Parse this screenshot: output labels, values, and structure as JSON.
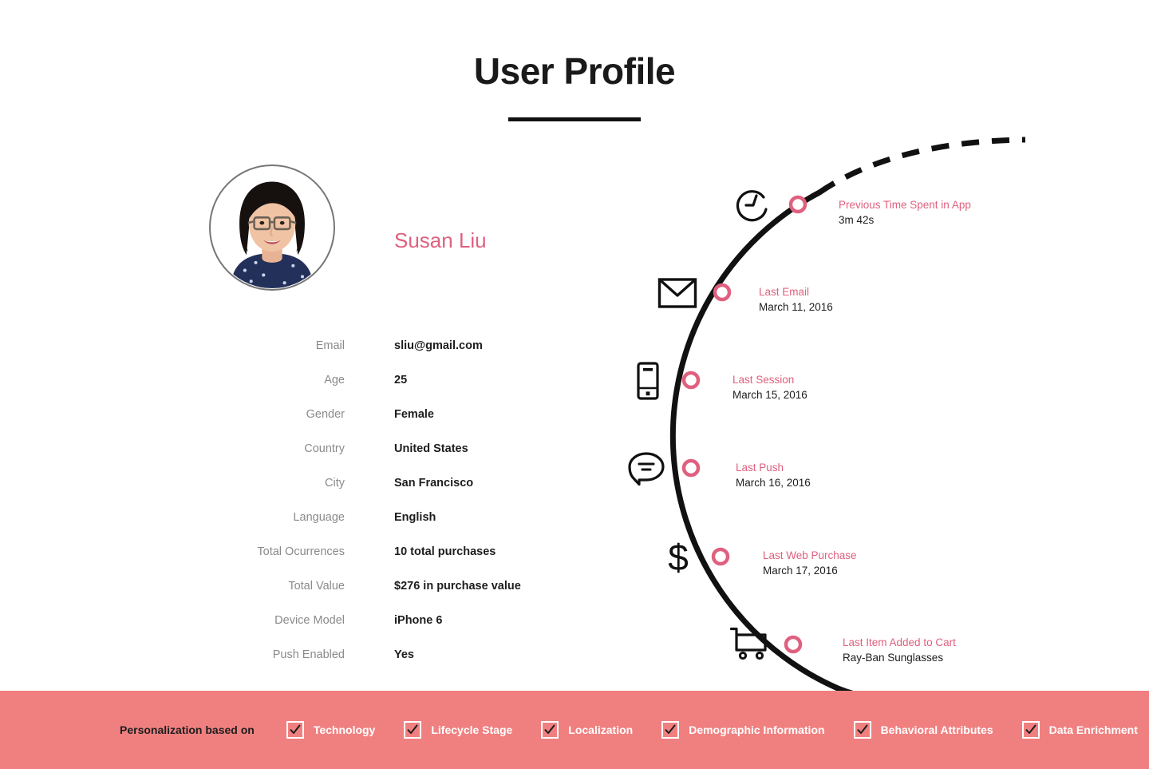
{
  "header": {
    "title": "User Profile"
  },
  "profile": {
    "avatar_icon": "user-photo",
    "name": "Susan Liu",
    "attributes": [
      {
        "label": "Email",
        "value": "sliu@gmail.com"
      },
      {
        "label": "Age",
        "value": "25"
      },
      {
        "label": "Gender",
        "value": "Female"
      },
      {
        "label": "Country",
        "value": "United States"
      },
      {
        "label": "City",
        "value": "San Francisco"
      },
      {
        "label": "Language",
        "value": "English"
      },
      {
        "label": "Total Ocurrences",
        "value": "10 total purchases"
      },
      {
        "label": "Total Value",
        "value": "$276 in purchase value"
      },
      {
        "label": "Device Model",
        "value": "iPhone 6"
      },
      {
        "label": "Push Enabled",
        "value": "Yes"
      }
    ]
  },
  "timeline": {
    "events": [
      {
        "icon": "clock-icon",
        "title": "Previous Time Spent in App",
        "detail": "3m 42s"
      },
      {
        "icon": "envelope-icon",
        "title": "Last Email",
        "detail": "March 11, 2016"
      },
      {
        "icon": "mobile-phone-icon",
        "title": "Last Session",
        "detail": "March 15, 2016"
      },
      {
        "icon": "speech-bubble-icon",
        "title": "Last Push",
        "detail": "March 16, 2016"
      },
      {
        "icon": "dollar-sign-icon",
        "title": "Last Web Purchase",
        "detail": "March 17, 2016"
      },
      {
        "icon": "shopping-cart-icon",
        "title": "Last Item Added to Cart",
        "detail": "Ray-Ban Sunglasses"
      }
    ]
  },
  "banner": {
    "label": "Personalization based on",
    "checkboxes": [
      {
        "label": "Technology",
        "checked": true
      },
      {
        "label": "Lifecycle Stage",
        "checked": true
      },
      {
        "label": "Localization",
        "checked": true
      },
      {
        "label": "Demographic Information",
        "checked": true
      },
      {
        "label": "Behavioral Attributes",
        "checked": true
      },
      {
        "label": "Data Enrichment",
        "checked": true
      }
    ]
  },
  "colors": {
    "accent_pink": "#e0607f",
    "banner_bg": "#f08080",
    "text_dark": "#1d1d1d",
    "label_gray": "#8a8a8a",
    "curve_black": "#111111"
  }
}
